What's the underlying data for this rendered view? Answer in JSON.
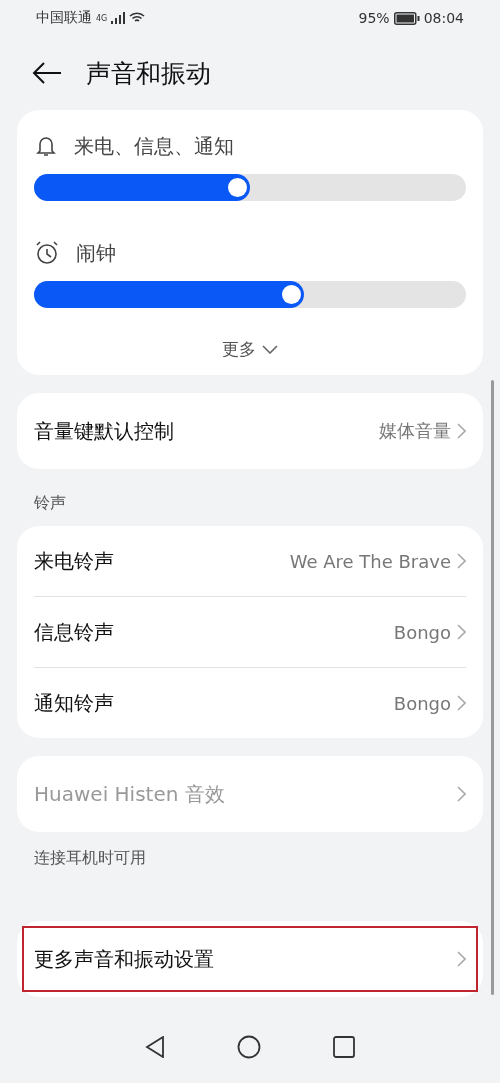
{
  "status_bar": {
    "carrier": "中国联通",
    "network": "4G",
    "battery": "95%",
    "time": "08:04"
  },
  "header": {
    "title": "声音和振动"
  },
  "volume_card": {
    "sliders": [
      {
        "kind": "bell",
        "label": "来电、信息、通知",
        "level": 0.47
      },
      {
        "kind": "alarm",
        "label": "闹钟",
        "level": 0.595
      }
    ],
    "more": "更多"
  },
  "sections": [
    {
      "items": [
        {
          "label": "音量键默认控制",
          "value": "媒体音量",
          "disabled": false,
          "highlighted": false
        }
      ]
    },
    {
      "heading": "铃声",
      "items": [
        {
          "label": "来电铃声",
          "value": "We Are The Brave",
          "disabled": false,
          "highlighted": false
        },
        {
          "label": "信息铃声",
          "value": "Bongo",
          "disabled": false,
          "highlighted": false
        },
        {
          "label": "通知铃声",
          "value": "Bongo",
          "disabled": false,
          "highlighted": false
        }
      ]
    },
    {
      "items": [
        {
          "label": "Huawei Histen 音效",
          "disabled": true,
          "highlighted": false
        }
      ],
      "footer": "连接耳机时可用"
    },
    {
      "items": [
        {
          "label": "更多声音和振动设置",
          "disabled": false,
          "highlighted": true
        }
      ]
    }
  ]
}
